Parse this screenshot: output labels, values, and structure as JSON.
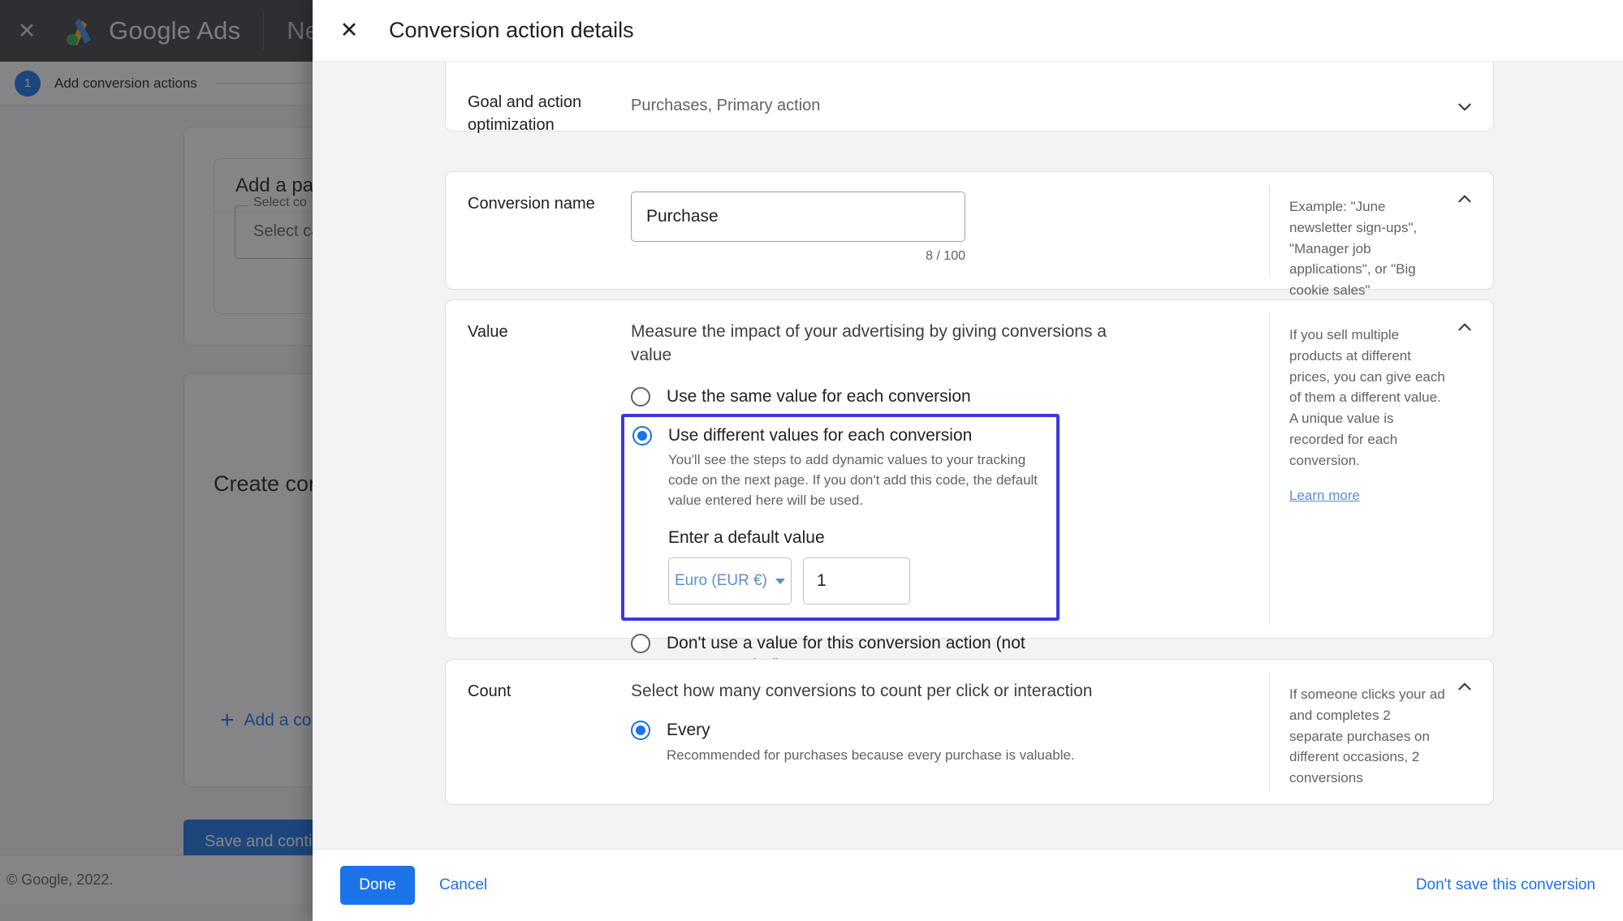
{
  "app": {
    "topbar": {
      "close_icon": "close-icon",
      "brand": "Google Ads",
      "secondary_label": "New"
    },
    "step": {
      "number": "1",
      "label": "Add conversion actions"
    },
    "cards": {
      "add_partner_title": "Add a pa",
      "select_legend": "Select co",
      "select_value": "Select ca",
      "create_conv_title": "Create cor",
      "add_conv_label": "Add a co",
      "save_button": "Save and contin"
    },
    "footer": "© Google, 2022."
  },
  "dialog": {
    "title": "Conversion action details",
    "close_icon": "close-icon",
    "sections": [
      {
        "id": "goal",
        "label": "Goal and action optimization",
        "value": "Purchases, Primary action",
        "chevron": "chevron-down-icon"
      },
      {
        "id": "name",
        "label": "Conversion name",
        "input_value": "Purchase",
        "input_placeholder": "Conversion name",
        "counter": "8 / 100",
        "aside": "Example: \"June newsletter sign-ups\", \"Manager job applications\", or \"Big cookie sales\"",
        "chevron": "chevron-up-icon"
      },
      {
        "id": "value",
        "label": "Value",
        "description": "Measure the impact of your advertising by giving conversions a value",
        "options": [
          {
            "label": "Use the same value for each conversion",
            "selected": false,
            "sub": ""
          },
          {
            "label": "Use different values for each conversion",
            "selected": true,
            "sub": "You'll see the steps to add dynamic values to your tracking code on the next page. If you don't add this code, the default value entered here will be used."
          },
          {
            "label": "Don't use a value for this conversion action (not recommended)",
            "selected": false,
            "sub": ""
          }
        ],
        "default_value_label": "Enter a default value",
        "currency": "Euro (EUR €)",
        "currency_caret": "caret-down-icon",
        "amount": "1",
        "aside": "If you sell multiple products at different prices, you can give each of them a different value. A unique value is recorded for each conversion.",
        "aside_link": "Learn more",
        "chevron": "chevron-up-icon"
      },
      {
        "id": "count",
        "label": "Count",
        "description": "Select how many conversions to count per click or interaction",
        "options": [
          {
            "label": "Every",
            "selected": true,
            "sub": "Recommended for purchases because every purchase is valuable."
          }
        ],
        "aside": "If someone clicks your ad and completes 2 separate purchases on different occasions, 2 conversions",
        "chevron": "chevron-up-icon"
      }
    ],
    "footer": {
      "done": "Done",
      "cancel": "Cancel",
      "dont_save": "Don't save this conversion"
    }
  },
  "colors": {
    "accent_blue": "#1a73e8",
    "highlight_border": "#3b38e0",
    "topbar_bg": "#3c4043",
    "dialog_bg": "#f1f3f4"
  }
}
